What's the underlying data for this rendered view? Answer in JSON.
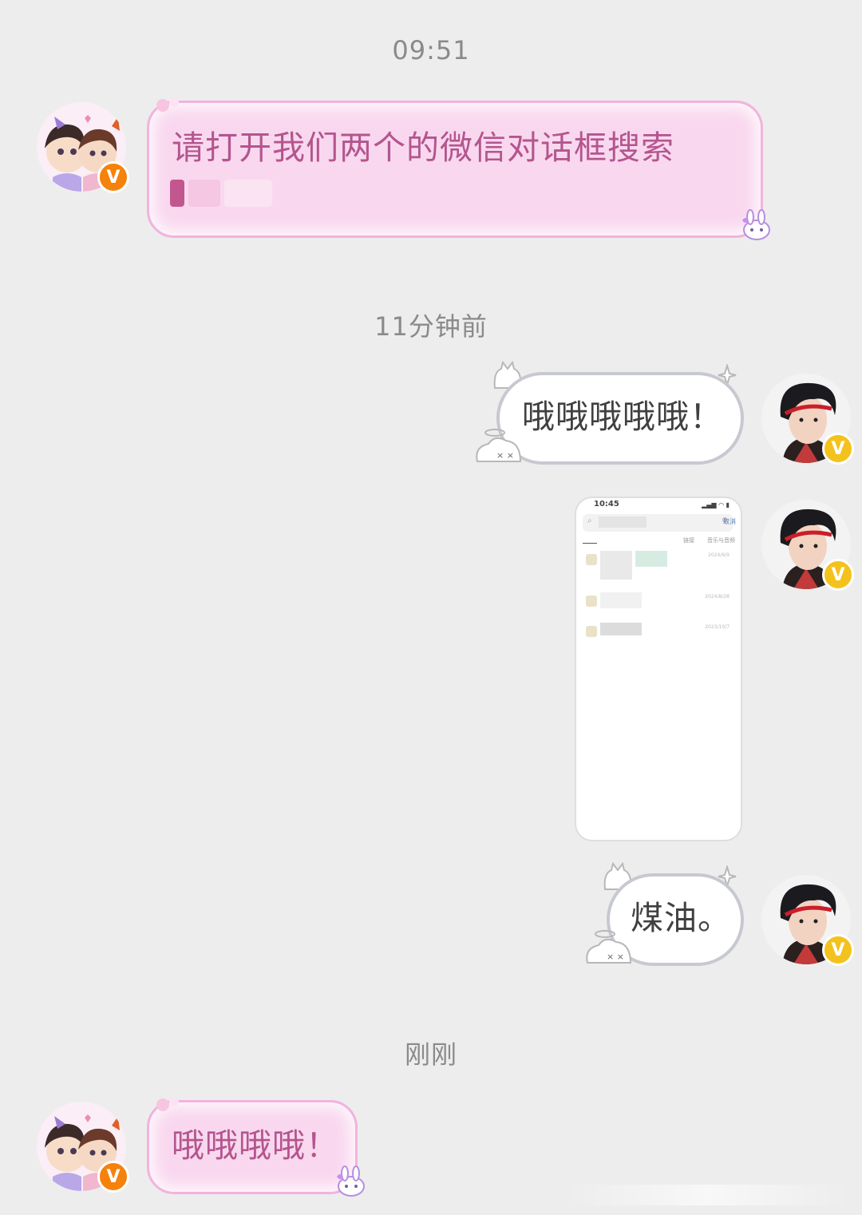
{
  "timestamps": {
    "first": "09:51",
    "second": "11分钟前",
    "third": "刚刚"
  },
  "messages": [
    {
      "sender": "other",
      "text": "请打开我们两个的微信对话框搜索"
    },
    {
      "sender": "self",
      "text": "哦哦哦哦哦！"
    },
    {
      "sender": "self",
      "type": "image"
    },
    {
      "sender": "self",
      "text": "煤油。"
    },
    {
      "sender": "other",
      "text": "哦哦哦哦！"
    }
  ],
  "screenshot": {
    "status_time": "10:45",
    "cancel_label": "取消",
    "tabs": [
      "链接",
      "音乐与音频"
    ],
    "dates": [
      "2024/6/9",
      "2024/8/28",
      "2023/10/7"
    ]
  },
  "badge": {
    "label": "V"
  },
  "colors": {
    "background": "#ededed",
    "pink_bubble": "#f9d8ef",
    "pink_text": "#b4558e",
    "white_bubble_border": "#c7c9d1",
    "badge_orange": "#f5820a",
    "badge_yellow": "#f4c21c"
  }
}
